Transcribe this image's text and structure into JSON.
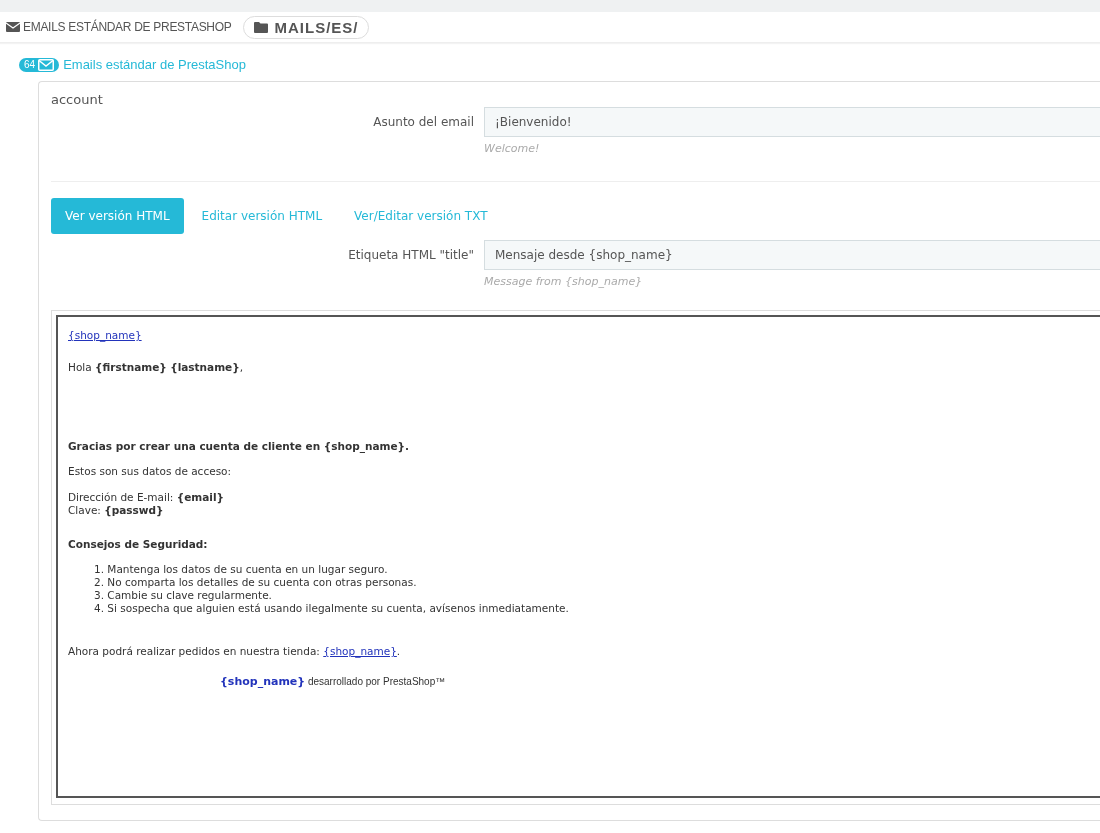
{
  "panel_header": {
    "title": "EMAILS ESTÁNDAR DE PRESTASHOP",
    "path": "MAILS/ES/"
  },
  "group": {
    "count": "64",
    "title": "Emails estándar de PrestaShop"
  },
  "template": {
    "name": "account",
    "subject": {
      "label": "Asunto del email",
      "value": "¡Bienvenido!",
      "hint": "Welcome!"
    },
    "tabs": [
      {
        "label": "Ver versión HTML",
        "selected": true
      },
      {
        "label": "Editar versión HTML",
        "selected": false
      },
      {
        "label": "Ver/Editar versión TXT",
        "selected": false
      }
    ],
    "title_tag": {
      "label": "Etiqueta HTML \"title\"",
      "value": "Mensaje desde {shop_name}",
      "hint": "Message from {shop_name}"
    }
  },
  "preview": {
    "header_link": "{shop_name}",
    "greeting": "Hola **{firstname}** **{lastname}**,",
    "heading": "Gracias por crear una cuenta de cliente en {shop_name}.",
    "intro": "Estos son sus datos de acceso:",
    "credentials": [
      "Dirección de E-mail: **{email}**",
      "Clave: **{passwd}**"
    ],
    "tips_title": "Consejos de Seguridad:",
    "tips": [
      "1. Mantenga los datos de su cuenta en un lugar seguro.",
      "2. No comparta los detalles de su cuenta con otras personas.",
      "3. Cambie su clave regularmente.",
      "4. Si sospecha que alguien está usando ilegalmente su cuenta, avísenos inmediatamente."
    ],
    "closing_text": "Ahora podrá realizar pedidos en nuestra tienda: ",
    "closing_link": "{shop_name}",
    "closing_end": ".",
    "footer": "**{shop_name}** desarrollado por PrestaShop™"
  }
}
